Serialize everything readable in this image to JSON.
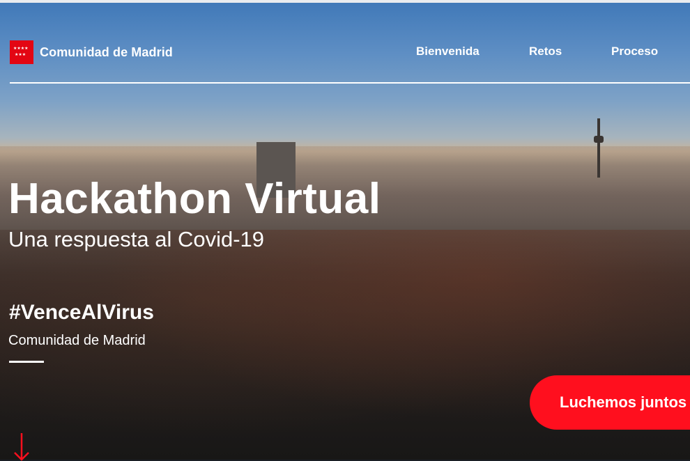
{
  "header": {
    "logo_text": "Comunidad de Madrid",
    "nav": [
      {
        "label": "Bienvenida"
      },
      {
        "label": "Retos"
      },
      {
        "label": "Proceso"
      }
    ]
  },
  "hero": {
    "title": "Hackathon Virtual",
    "subtitle": "Una respuesta al Covid-19",
    "hashtag": "#VenceAlVirus",
    "organizer": "Comunidad de Madrid",
    "cta_label": "Luchemos juntos"
  },
  "icons": {
    "logo": "madrid-flag-icon",
    "scroll": "arrow-down-icon"
  },
  "colors": {
    "accent": "#ff0f1e",
    "flag_red": "#e30613",
    "text": "#ffffff"
  }
}
